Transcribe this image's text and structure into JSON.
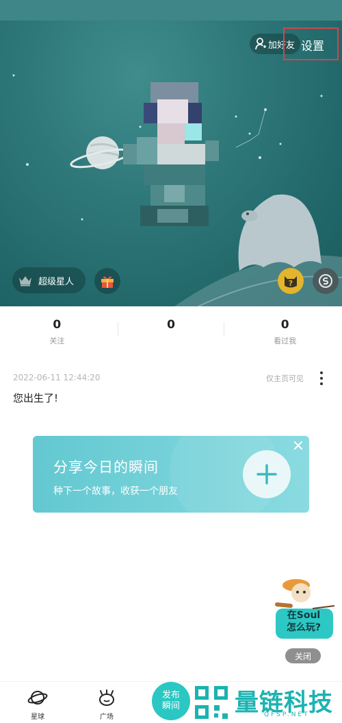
{
  "header": {
    "add_friend_label": "加好友",
    "settings_label": "设置"
  },
  "profile": {
    "level_label": "超级星人"
  },
  "stats": [
    {
      "value": "0",
      "label": "关注"
    },
    {
      "value": "0",
      "label": ""
    },
    {
      "value": "0",
      "label": "看过我"
    }
  ],
  "post": {
    "time": "2022-06-11 12:44:20",
    "visibility": "仅主页可见",
    "content": "您出生了!"
  },
  "share_card": {
    "title": "分享今日的瞬间",
    "subtitle": "种下一个故事，收获一个朋友"
  },
  "mascot": {
    "text_line1": "在Soul",
    "text_line2": "怎么玩?",
    "close_label": "关闭"
  },
  "bottom_nav": {
    "planet_label": "星球",
    "square_label": "广场",
    "publish_line1": "发布",
    "publish_line2": "瞬间"
  },
  "watermark": {
    "text": "量链科技",
    "subtext": "QFSP.NET"
  },
  "colors": {
    "hero_bg": "#2e7779",
    "accent": "#2bc7c2",
    "settings_highlight": "#d9424a",
    "cat_badge": "#e3b52c"
  }
}
